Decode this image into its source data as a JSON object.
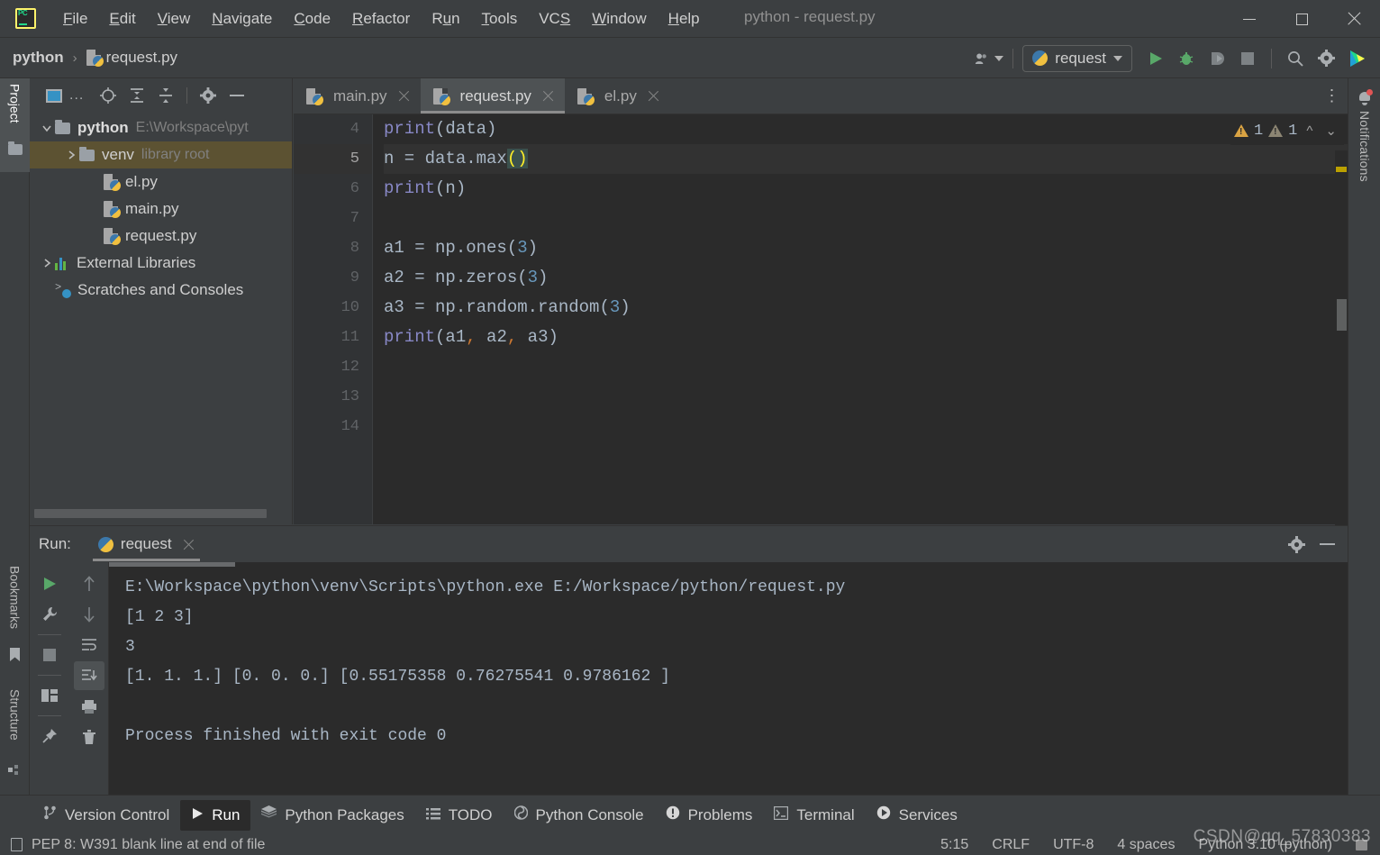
{
  "window": {
    "title": "python - request.py",
    "app_icon": "pycharm-logo-icon",
    "minimize": "minimize-icon",
    "maximize": "maximize-icon",
    "close": "close-icon"
  },
  "menu": [
    {
      "label": "File",
      "mnemonic": "F"
    },
    {
      "label": "Edit",
      "mnemonic": "E"
    },
    {
      "label": "View",
      "mnemonic": "V"
    },
    {
      "label": "Navigate",
      "mnemonic": "N"
    },
    {
      "label": "Code",
      "mnemonic": "C"
    },
    {
      "label": "Refactor",
      "mnemonic": "R"
    },
    {
      "label": "Run",
      "mnemonic": "u"
    },
    {
      "label": "Tools",
      "mnemonic": "T"
    },
    {
      "label": "VCS",
      "mnemonic": "S"
    },
    {
      "label": "Window",
      "mnemonic": "W"
    },
    {
      "label": "Help",
      "mnemonic": "H"
    }
  ],
  "navbar": {
    "crumb_project": "python",
    "crumb_separator": "›",
    "crumb_file": "request.py",
    "run_config": "request",
    "icons": {
      "user": "user-account-icon",
      "run": "run-icon",
      "debug": "debug-icon",
      "coverage": "run-with-coverage-icon",
      "stop": "stop-icon",
      "search": "search-everywhere-icon",
      "settings": "settings-gear-icon",
      "ide_avatar": "ide-avatar-icon"
    }
  },
  "left_strip": {
    "project_tab": "Project",
    "bookmarks_tab": "Bookmarks",
    "structure_tab": "Structure"
  },
  "right_strip": {
    "notifications_tab": "Notifications"
  },
  "project_panel": {
    "toolbar": {
      "select_opened": "select-opened-file-icon",
      "more": "...",
      "locate": "scroll-from-source-icon",
      "expand_all": "expand-all-icon",
      "collapse_all": "collapse-all-icon",
      "settings": "options-gear-icon",
      "hide": "hide-panel-icon"
    },
    "tree": [
      {
        "label": "python",
        "sublabel": "E:\\Workspace\\pyt",
        "type": "folder",
        "expanded": true,
        "depth": 0,
        "selected": false
      },
      {
        "label": "venv",
        "sublabel": "library root",
        "type": "folder",
        "expanded": false,
        "depth": 1,
        "selected": true
      },
      {
        "label": "el.py",
        "sublabel": "",
        "type": "python",
        "depth": 2,
        "selected": false
      },
      {
        "label": "main.py",
        "sublabel": "",
        "type": "python",
        "depth": 2,
        "selected": false
      },
      {
        "label": "request.py",
        "sublabel": "",
        "type": "python",
        "depth": 2,
        "selected": false
      },
      {
        "label": "External Libraries",
        "sublabel": "",
        "type": "libraries",
        "expanded": false,
        "depth": 0,
        "selected": false
      },
      {
        "label": "Scratches and Consoles",
        "sublabel": "",
        "type": "scratches",
        "depth": 0,
        "selected": false
      }
    ]
  },
  "editor": {
    "tabs": [
      {
        "label": "main.py",
        "active": false
      },
      {
        "label": "request.py",
        "active": true
      },
      {
        "label": "el.py",
        "active": false
      }
    ],
    "more_tabs": "⋮",
    "line_numbers": [
      4,
      5,
      6,
      7,
      8,
      9,
      10,
      11,
      12,
      13,
      14
    ],
    "current_line": 5,
    "code_lines": [
      {
        "n": 4,
        "tokens": [
          {
            "t": "print",
            "c": "func"
          },
          {
            "t": "(data)",
            "c": "plain"
          }
        ]
      },
      {
        "n": 5,
        "tokens": [
          {
            "t": "n = data.max",
            "c": "plain"
          },
          {
            "t": "()",
            "c": "brace"
          }
        ]
      },
      {
        "n": 6,
        "tokens": [
          {
            "t": "print",
            "c": "func"
          },
          {
            "t": "(n)",
            "c": "plain"
          }
        ]
      },
      {
        "n": 7,
        "tokens": []
      },
      {
        "n": 8,
        "tokens": [
          {
            "t": "a1 = np.ones(",
            "c": "plain"
          },
          {
            "t": "3",
            "c": "num"
          },
          {
            "t": ")",
            "c": "plain"
          }
        ]
      },
      {
        "n": 9,
        "tokens": [
          {
            "t": "a2 = np.zeros(",
            "c": "plain"
          },
          {
            "t": "3",
            "c": "num"
          },
          {
            "t": ")",
            "c": "plain"
          }
        ]
      },
      {
        "n": 10,
        "tokens": [
          {
            "t": "a3 = np.random.random(",
            "c": "plain"
          },
          {
            "t": "3",
            "c": "num"
          },
          {
            "t": ")",
            "c": "plain"
          }
        ]
      },
      {
        "n": 11,
        "tokens": [
          {
            "t": "print",
            "c": "func"
          },
          {
            "t": "(a1",
            "c": "plain"
          },
          {
            "t": ",",
            "c": "comma"
          },
          {
            "t": " a2",
            "c": "plain"
          },
          {
            "t": ",",
            "c": "comma"
          },
          {
            "t": " a3)",
            "c": "plain"
          }
        ]
      },
      {
        "n": 12,
        "tokens": []
      },
      {
        "n": 13,
        "tokens": []
      },
      {
        "n": 14,
        "tokens": []
      }
    ],
    "inspections": {
      "warning_count": "1",
      "weak_warning_count": "1",
      "prev_icon": "previous-highlight-icon",
      "next_icon": "next-highlight-icon"
    }
  },
  "run_panel": {
    "label": "Run:",
    "tab_name": "request",
    "close_icon": "close-icon",
    "header_icons": {
      "settings": "settings-gear-icon",
      "hide": "hide-panel-icon"
    },
    "left_tools": [
      {
        "name": "rerun-icon"
      },
      {
        "name": "wrench-settings-icon"
      },
      {
        "name": "stop-icon"
      },
      {
        "name": "layout-icon"
      },
      {
        "name": "pin-tab-icon"
      }
    ],
    "console_tools": [
      {
        "name": "up-arrow-icon"
      },
      {
        "name": "down-arrow-icon"
      },
      {
        "name": "soft-wrap-icon"
      },
      {
        "name": "scroll-to-end-icon",
        "selected": true
      },
      {
        "name": "print-icon"
      },
      {
        "name": "clear-all-icon"
      }
    ],
    "console_output": [
      "E:\\Workspace\\python\\venv\\Scripts\\python.exe E:/Workspace/python/request.py",
      "[1 2 3]",
      "3",
      "[1. 1. 1.] [0. 0. 0.] [0.55175358 0.76275541 0.9786162 ]",
      "",
      "Process finished with exit code 0"
    ]
  },
  "bottom_bar": [
    {
      "label": "Version Control",
      "icon": "version-control-icon",
      "active": false
    },
    {
      "label": "Run",
      "icon": "run-icon",
      "active": true
    },
    {
      "label": "Python Packages",
      "icon": "packages-icon",
      "active": false
    },
    {
      "label": "TODO",
      "icon": "todo-list-icon",
      "active": false
    },
    {
      "label": "Python Console",
      "icon": "python-console-icon",
      "active": false
    },
    {
      "label": "Problems",
      "icon": "problems-icon",
      "active": false
    },
    {
      "label": "Terminal",
      "icon": "terminal-icon",
      "active": false
    },
    {
      "label": "Services",
      "icon": "services-icon",
      "active": false
    }
  ],
  "status_bar": {
    "message": "PEP 8: W391 blank line at end of file",
    "caret_position": "5:15",
    "line_separator": "CRLF",
    "encoding": "UTF-8",
    "indent": "4 spaces",
    "interpreter": "Python 3.10 (python)",
    "lock_icon": "read-only-toggle-icon"
  },
  "watermark": "CSDN@qq_57830383"
}
